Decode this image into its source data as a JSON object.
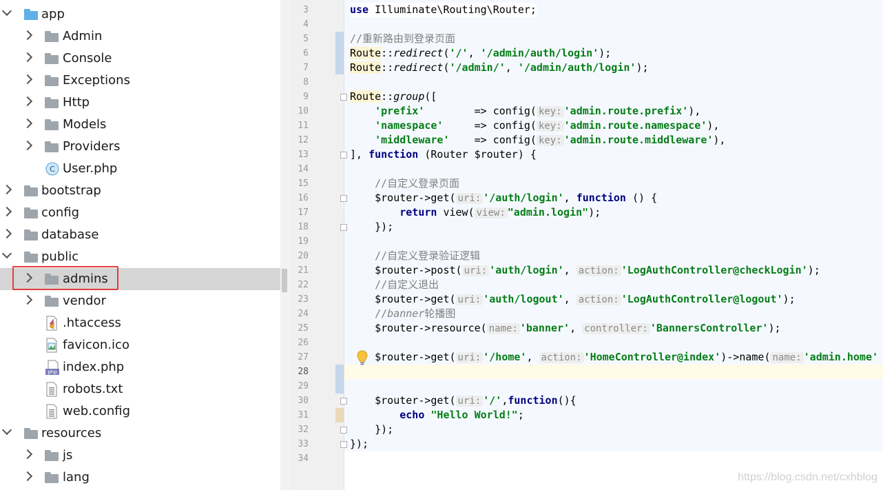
{
  "tree": {
    "items": [
      {
        "label": "app"
      },
      {
        "label": "Admin"
      },
      {
        "label": "Console"
      },
      {
        "label": "Exceptions"
      },
      {
        "label": "Http"
      },
      {
        "label": "Models"
      },
      {
        "label": "Providers"
      },
      {
        "label": "User.php",
        "badge": "C"
      },
      {
        "label": "bootstrap"
      },
      {
        "label": "config"
      },
      {
        "label": "database"
      },
      {
        "label": "public"
      },
      {
        "label": "admins"
      },
      {
        "label": "vendor"
      },
      {
        "label": ".htaccess"
      },
      {
        "label": "favicon.ico"
      },
      {
        "label": "index.php",
        "badge": "php"
      },
      {
        "label": "robots.txt"
      },
      {
        "label": "web.config"
      },
      {
        "label": "resources"
      },
      {
        "label": "js"
      },
      {
        "label": "lang"
      }
    ]
  },
  "editor": {
    "line_numbers": [
      "3",
      "4",
      "5",
      "6",
      "7",
      "8",
      "9",
      "10",
      "11",
      "12",
      "13",
      "14",
      "15",
      "16",
      "17",
      "18",
      "19",
      "20",
      "21",
      "22",
      "23",
      "24",
      "25",
      "26",
      "27",
      "28",
      "29",
      "30",
      "31",
      "32",
      "33",
      "34"
    ],
    "current_line": "28",
    "tokens": {
      "l3a": "use",
      "l3b": " Illuminate\\Routing\\Router;",
      "l5": "//重新路由到登录页面",
      "l6a": "Route",
      "l6b": "::",
      "l6c": "redirect",
      "l6d": "(",
      "l6e": "'/'",
      "l6f": ", ",
      "l6g": "'/admin/auth/login'",
      "l6h": ");",
      "l7a": "Route",
      "l7b": "::",
      "l7c": "redirect",
      "l7d": "(",
      "l7e": "'/admin/'",
      "l7f": ", ",
      "l7g": "'/admin/auth/login'",
      "l7h": ");",
      "l9a": "Route",
      "l9b": "::",
      "l9c": "group",
      "l9d": "([",
      "l10a": "    ",
      "l10b": "'prefix'",
      "l10c": "        => config(",
      "l10d": "key:",
      "l10e": "'admin.route.prefix'",
      "l10f": "),",
      "l11a": "    ",
      "l11b": "'namespace'",
      "l11c": "     => config(",
      "l11d": "key:",
      "l11e": "'admin.route.namespace'",
      "l11f": "),",
      "l12a": "    ",
      "l12b": "'middleware'",
      "l12c": "    => config(",
      "l12d": "key:",
      "l12e": "'admin.route.middleware'",
      "l12f": "),",
      "l13a": "], ",
      "l13b": "function",
      "l13c": " (Router $router) {",
      "l15": "    //自定义登录页面",
      "l16a": "    $router->get(",
      "l16b": "uri:",
      "l16c": "'/auth/login'",
      "l16d": ", ",
      "l16e": "function",
      "l16f": " () {",
      "l17a": "        ",
      "l17b": "return",
      "l17c": " view(",
      "l17d": "view:",
      "l17e": "\"admin.login\"",
      "l17f": ");",
      "l18": "    });",
      "l20": "    //自定义登录验证逻辑",
      "l21a": "    $router->post(",
      "l21b": "uri:",
      "l21c": "'auth/login'",
      "l21d": ", ",
      "l21e": "action:",
      "l21f": "'LogAuthController@checkLogin'",
      "l21g": ");",
      "l22": "    //自定义退出",
      "l23a": "    $router->get(",
      "l23b": "uri:",
      "l23c": "'auth/logout'",
      "l23d": ", ",
      "l23e": "action:",
      "l23f": "'LogAuthController@logout'",
      "l23g": ");",
      "l24a": "    //",
      "l24b": "banner",
      "l24c": "轮播图",
      "l25a": "    $router->resource(",
      "l25b": "name:",
      "l25c": "'banner'",
      "l25d": ", ",
      "l25e": "controller:",
      "l25f": "'BannersController'",
      "l25g": ");",
      "l27a": "    $router->get(",
      "l27b": "uri:",
      "l27c": "'/home'",
      "l27d": ", ",
      "l27e": "action:",
      "l27f": "'HomeController@index'",
      "l27g": ")->name(",
      "l27h": "name:",
      "l27i": "'admin.home'",
      "l30a": "    $router->get(",
      "l30b": "uri:",
      "l30c": "'/'",
      "l30d": ",",
      "l30e": "function",
      "l30f": "(){",
      "l31a": "        ",
      "l31b": "echo",
      "l31c": " ",
      "l31d": "\"Hello World!\"",
      "l31e": ";",
      "l32": "    });",
      "l33": "});"
    }
  },
  "watermark": "https://blog.csdn.net/cxhblog"
}
